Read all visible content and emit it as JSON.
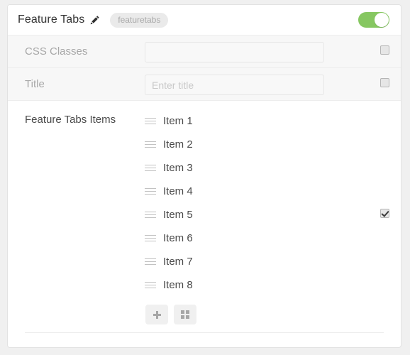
{
  "panel": {
    "title": "Feature Tabs",
    "edit_icon": "pencil-icon",
    "tag": "featuretabs",
    "enabled_toggle": {
      "name": "enable-toggle",
      "state": "on",
      "color": "#86c761"
    }
  },
  "fields": [
    {
      "label": "CSS Classes",
      "value": "",
      "placeholder": "",
      "checkbox_checked": false
    },
    {
      "label": "Title",
      "value": "",
      "placeholder": "Enter title",
      "checkbox_checked": false
    }
  ],
  "items_section": {
    "label": "Feature Tabs Items",
    "checkbox_checked": true,
    "checkbox_row_index": 5,
    "items": [
      {
        "label": "Item 1",
        "handle": "drag-handle-icon"
      },
      {
        "label": "Item 2",
        "handle": "drag-handle-icon"
      },
      {
        "label": "Item 3",
        "handle": "drag-handle-icon"
      },
      {
        "label": "Item 4",
        "handle": "drag-handle-icon"
      },
      {
        "label": "Item 5",
        "handle": "drag-handle-icon"
      },
      {
        "label": "Item 6",
        "handle": "drag-handle-icon"
      },
      {
        "label": "Item 7",
        "handle": "drag-handle-icon"
      },
      {
        "label": "Item 8",
        "handle": "drag-handle-icon"
      }
    ],
    "actions": [
      {
        "name": "add-item-button",
        "icon": "plus-icon"
      },
      {
        "name": "grid-view-button",
        "icon": "grid-icon"
      }
    ]
  },
  "colors": {
    "accent_green": "#86c761",
    "panel_background": "#ffffff",
    "page_background": "#f0f0f0",
    "row_background": "#f7f7f7",
    "label_text": "#a7a7a7",
    "item_text": "#4a4a4a",
    "placeholder_text": "#c9c9c9"
  }
}
